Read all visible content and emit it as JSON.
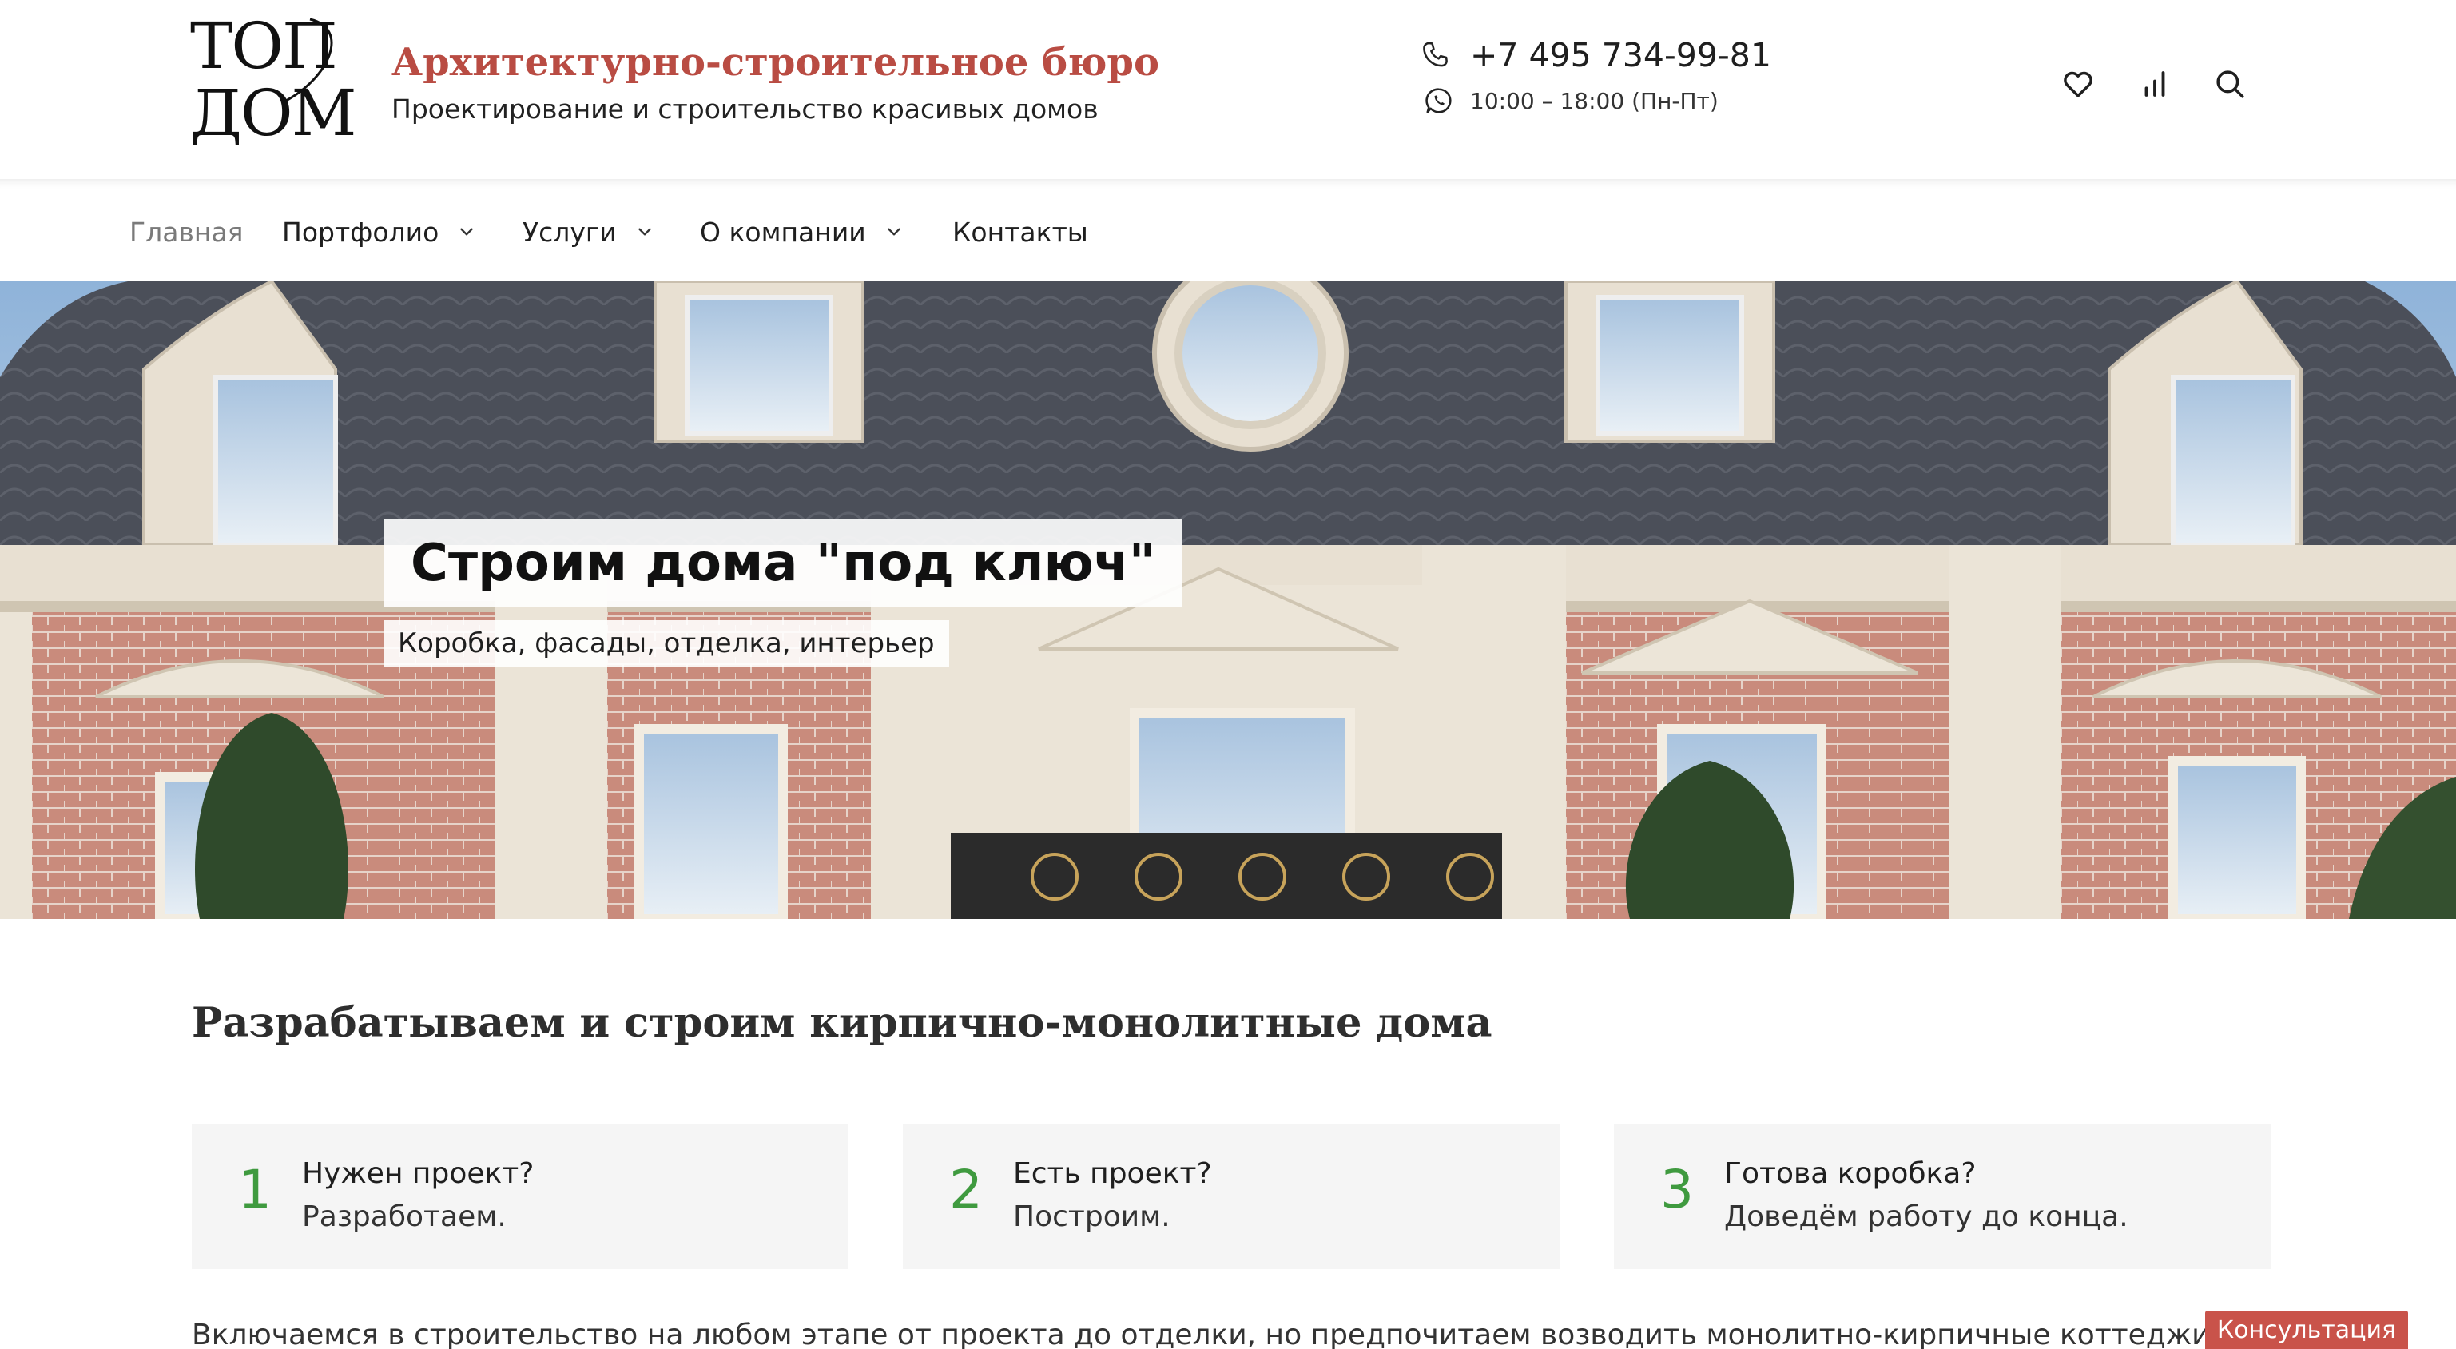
{
  "logo": {
    "line1": "ТОП",
    "line2": "ДОМ"
  },
  "brand": {
    "title": "Архитектурно-строительное бюро",
    "subtitle": "Проектирование и строительство красивых домов"
  },
  "contacts": {
    "phone": "+7 495 734-99-81",
    "hours": "10:00 – 18:00 (Пн-Пт)",
    "phone_icon": "phone-icon",
    "whatsapp_icon": "whatsapp-icon"
  },
  "header_icons": [
    "heart-icon",
    "compare-icon",
    "search-icon"
  ],
  "nav": {
    "home": "Главная",
    "portfolio": "Портфолио",
    "services": "Услуги",
    "about": "О компании",
    "contacts": "Контакты"
  },
  "hero": {
    "title": "Строим дома \"под ключ\"",
    "subtitle": "Коробка, фасады, отделка, интерьер"
  },
  "section": {
    "title": "Разрабатываем и строим кирпично-монолитные дома"
  },
  "steps": [
    {
      "number": "1",
      "question": "Нужен проект?",
      "answer": "Разработаем."
    },
    {
      "number": "2",
      "question": "Есть проект?",
      "answer": "Построим."
    },
    {
      "number": "3",
      "question": "Готова коробка?",
      "answer": "Доведём работу до конца."
    }
  ],
  "bottom_text": "Включаемся в строительство на любом этапе от проекта до отделки, но предпочитаем возводить монолитно-кирпичные коттеджи под ключ.",
  "consult_button": "Консультация",
  "colors": {
    "brand_red": "#b94c43",
    "accent_green": "#3f9a3f",
    "button_red": "#c9534a",
    "card_bg": "#f5f5f5"
  }
}
